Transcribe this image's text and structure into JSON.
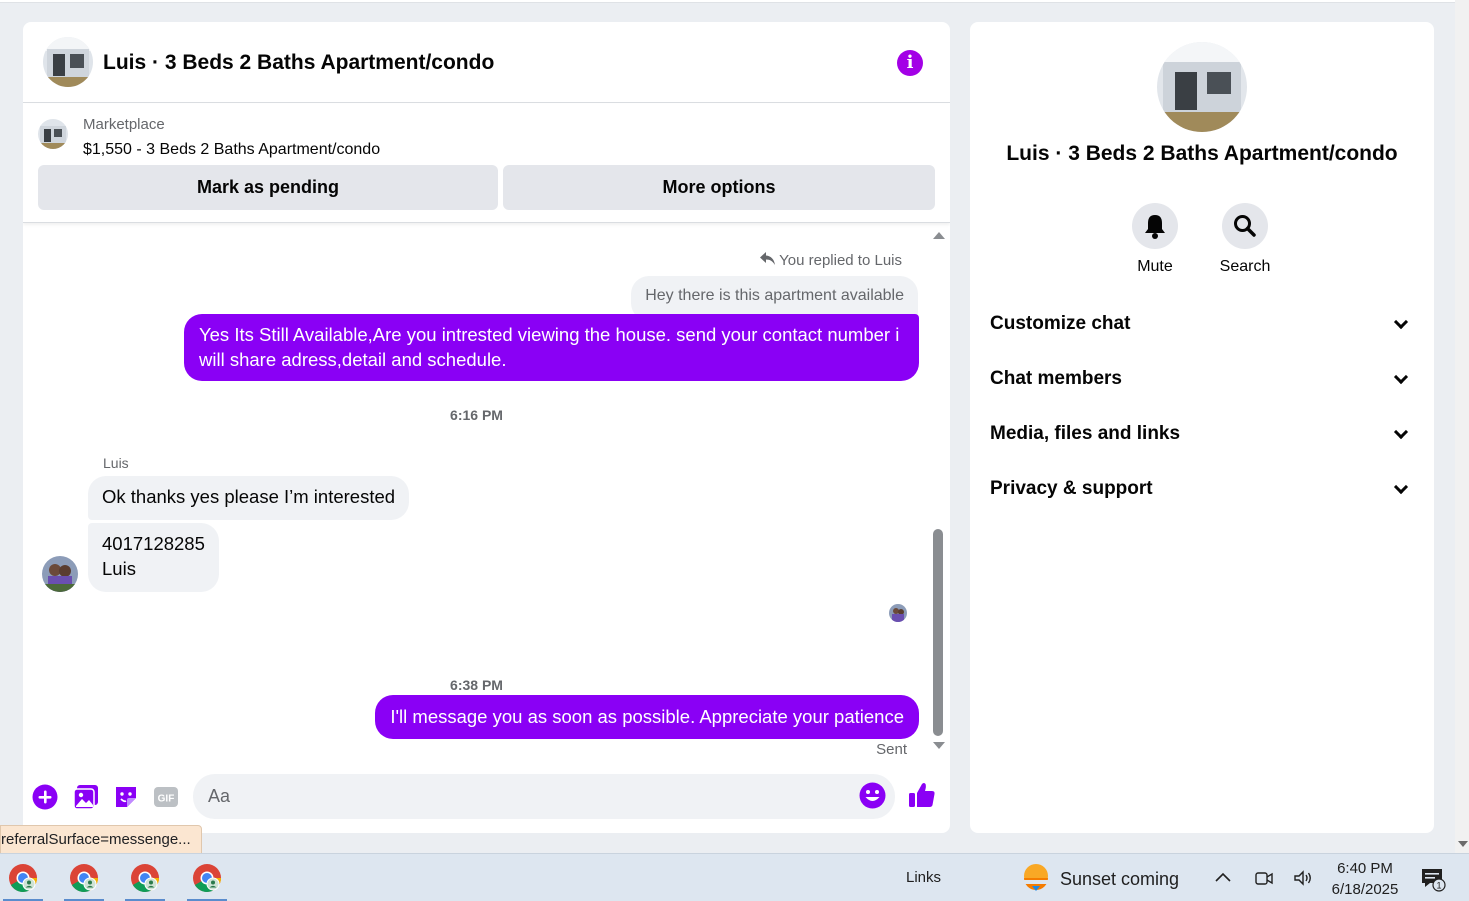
{
  "header": {
    "title": "Luis · 3 Beds 2 Baths Apartment/condo",
    "info_icon_glyph": "i"
  },
  "marketplace": {
    "label": "Marketplace",
    "listing": "$1,550 - 3 Beds 2 Baths Apartment/condo",
    "mark_pending_label": "Mark as pending",
    "more_options_label": "More options"
  },
  "messages": {
    "replied_note": "You replied to Luis",
    "quoted_text": "Hey there is this apartment available",
    "outgoing_1": "Yes Its Still Available,Are you intrested viewing the house. send your contact number i will share adress,detail and schedule.",
    "time_1": "6:16 PM",
    "sender_name": "Luis",
    "incoming_1": "Ok thanks yes please I’m interested",
    "incoming_2_line1": "4017128285",
    "incoming_2_line2": "Luis",
    "time_2": "6:38 PM",
    "outgoing_2": "I'll message you as soon as possible. Appreciate your patience",
    "status": "Sent"
  },
  "composer": {
    "placeholder": "Aa",
    "gif_label": "GIF"
  },
  "tooltip": {
    "text": "referralSurface=messenge..."
  },
  "info_panel": {
    "title": "Luis · 3 Beds 2 Baths Apartment/condo",
    "mute_label": "Mute",
    "search_label": "Search",
    "sections": [
      "Customize chat",
      "Chat members",
      "Media, files and links",
      "Privacy & support"
    ]
  },
  "taskbar": {
    "links_label": "Links",
    "weather_text": "Sunset coming",
    "time": "6:40 PM",
    "date": "6/18/2025",
    "notification_count": "1"
  },
  "colors": {
    "accent": "#8a00f5",
    "info_icon": "#a300e6"
  },
  "icons": [
    "info-icon",
    "reply-icon",
    "plus-icon",
    "image-icon",
    "sticker-icon",
    "gif-icon",
    "emoji-icon",
    "thumbs-up-icon",
    "bell-icon",
    "search-icon",
    "chevron-down-icon",
    "chrome-icon",
    "weather-icon",
    "notification-icon"
  ]
}
